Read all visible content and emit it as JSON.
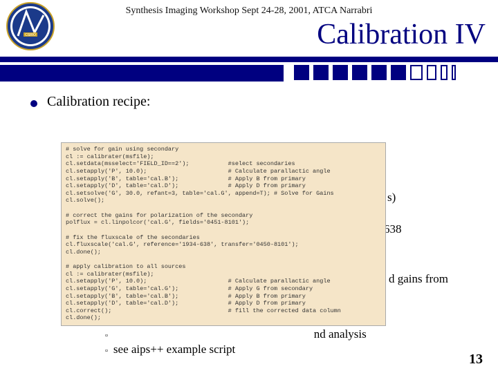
{
  "header": {
    "workshop": "Synthesis Imaging Workshop Sept 24-28, 2001, ATCA Narrabri",
    "title": "Calibration IV"
  },
  "main": {
    "bullet": "Calibration recipe:"
  },
  "code": {
    "text": "# solve for gain using secondary\ncl := calibrater(msfile);\ncl.setdata(msselect='FIELD_ID==2');           #select secondaries\ncl.setapply('P', 10.0);                       # Calculate parallactic angle\ncl.setapply('B', table='cal.B');              # Apply B from primary\ncl.setapply('D', table='cal.D');              # Apply D from primary\ncl.setsolve('G', 30.0, refant=3, table='cal.G', append=T); # Solve for Gains\ncl.solve();\n\n# correct the gains for polarization of the secondary\npolflux = cl.linpolcor('cal.G', fields='0451-8101');\n\n# fix the fluxscale of the secondaries\ncl.fluxscale('cal.G', reference='1934-638', transfer='0450-8101');\ncl.done();\n\n# apply calibration to all sources\ncl := calibrater(msfile);\ncl.setapply('P', 10.0);                       # Calculate parallactic angle\ncl.setapply('G', table='cal.G');              # Apply G from secondary\ncl.setapply('B', table='cal.B');              # Apply B from primary\ncl.setapply('D', table='cal.D');              # Apply D from primary\ncl.correct();                                 # fill the corrected data column\ncl.done();"
  },
  "behind": {
    "sources": "s)",
    "ref638": "638",
    "gains_from": "d gains from"
  },
  "footer": {
    "line_end": "nd analysis",
    "line2": "see aips++ example script"
  },
  "page": "13"
}
